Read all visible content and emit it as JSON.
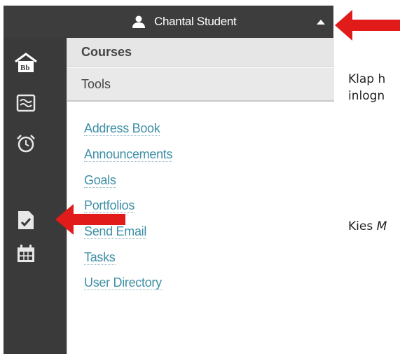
{
  "topbar": {
    "user_name": "Chantal Student"
  },
  "rail": {
    "icons": [
      "bb-home-icon",
      "stream-icon",
      "alarm-clock-icon",
      "tools-check-icon",
      "calendar-icon"
    ]
  },
  "menu": {
    "sections": {
      "courses": "Courses",
      "tools": "Tools"
    },
    "tools": [
      "Address Book",
      "Announcements",
      "Goals",
      "Portfolios",
      "Send Email",
      "Tasks",
      "User Directory"
    ]
  },
  "notes": {
    "line1": "Klap h",
    "line2": "inlogn",
    "line3": "Kies ",
    "line3_italic": "M"
  },
  "colors": {
    "arrow": "#e11a1a",
    "link": "#3f8fa6",
    "bar": "#3d3d3d"
  }
}
